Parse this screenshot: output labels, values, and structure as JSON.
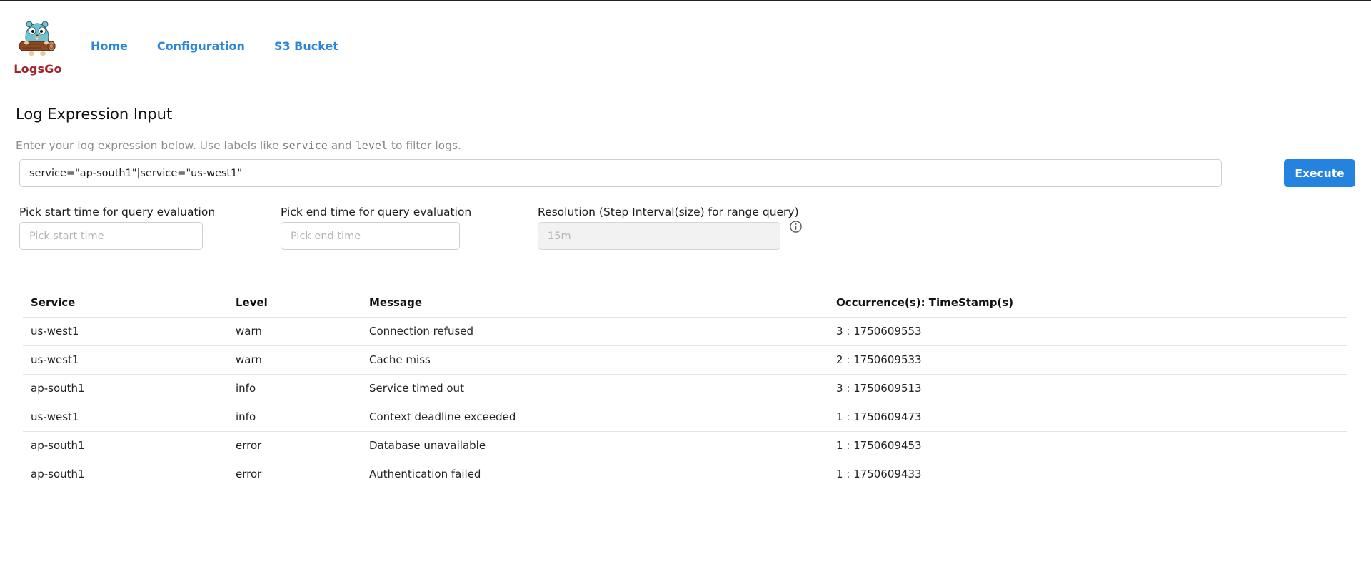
{
  "app": {
    "name": "LogsGo",
    "brand_color": "#a3232a",
    "logo_icon": "gopher-holding-log-icon"
  },
  "nav": {
    "items": [
      {
        "label": "Home"
      },
      {
        "label": "Configuration"
      },
      {
        "label": "S3 Bucket"
      }
    ],
    "link_color": "#2c86d7"
  },
  "section": {
    "title": "Log Expression Input",
    "helper": {
      "prefix": "Enter your log expression below. Use labels like ",
      "code1": "service",
      "middle": " and ",
      "code2": "level",
      "suffix": " to filter logs."
    }
  },
  "expression": {
    "value": "service=\"ap-south1\"|service=\"us-west1\""
  },
  "execute_button": {
    "label": "Execute",
    "color": "#2383df"
  },
  "fields": {
    "start": {
      "label": "Pick start time for query evaluation",
      "placeholder": "Pick start time",
      "value": ""
    },
    "end": {
      "label": "Pick end time for query evaluation",
      "placeholder": "Pick end time",
      "value": ""
    },
    "resolution": {
      "label": "Resolution (Step Interval(size) for range query)",
      "placeholder": "15m",
      "value": "",
      "disabled": true,
      "info_icon": "info-circle-icon"
    }
  },
  "table": {
    "headers": [
      "Service",
      "Level",
      "Message",
      "Occurrence(s): TimeStamp(s)"
    ],
    "rows": [
      [
        "us-west1",
        "warn",
        "Connection refused",
        "3 : 1750609553"
      ],
      [
        "us-west1",
        "warn",
        "Cache miss",
        "2 : 1750609533"
      ],
      [
        "ap-south1",
        "info",
        "Service timed out",
        "3 : 1750609513"
      ],
      [
        "us-west1",
        "info",
        "Context deadline exceeded",
        "1 : 1750609473"
      ],
      [
        "ap-south1",
        "error",
        "Database unavailable",
        "1 : 1750609453"
      ],
      [
        "ap-south1",
        "error",
        "Authentication failed",
        "1 : 1750609433"
      ]
    ]
  }
}
